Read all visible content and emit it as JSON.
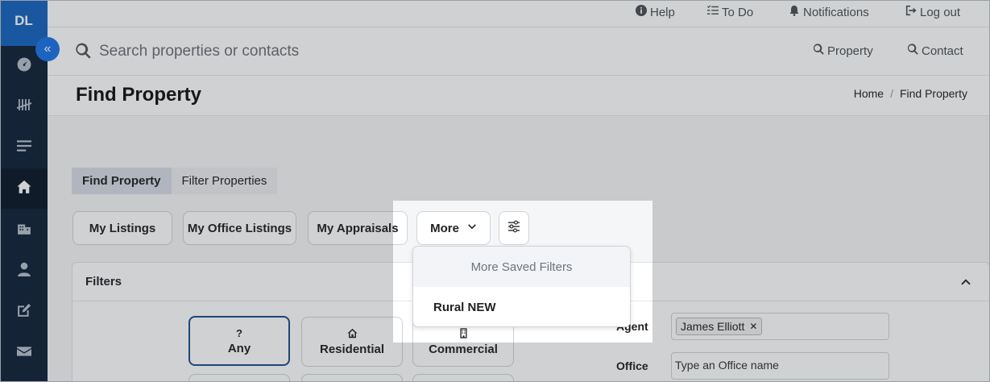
{
  "app": {
    "logo": "DL"
  },
  "sidebar": {
    "collapse_icon": "double-chevron-left-icon",
    "items": [
      {
        "name": "dashboard",
        "icon": "gauge-icon"
      },
      {
        "name": "tally",
        "icon": "tally-icon"
      },
      {
        "name": "list",
        "icon": "list-icon"
      },
      {
        "name": "home",
        "icon": "home-icon",
        "active": true
      },
      {
        "name": "buildings",
        "icon": "building-icon"
      },
      {
        "name": "contacts",
        "icon": "person-icon"
      },
      {
        "name": "edit",
        "icon": "pencil-square-icon"
      },
      {
        "name": "mail",
        "icon": "envelope-icon"
      }
    ]
  },
  "topnav": {
    "help": "Help",
    "todo": "To Do",
    "notifications": "Notifications",
    "logout": "Log out"
  },
  "search": {
    "placeholder": "Search properties or contacts",
    "property": "Property",
    "contact": "Contact"
  },
  "page": {
    "title": "Find Property",
    "breadcrumb": {
      "home": "Home",
      "separator": "/",
      "current": "Find Property"
    }
  },
  "tabs": {
    "find": "Find Property",
    "filter": "Filter Properties"
  },
  "quick_filters": {
    "my_listings": "My Listings",
    "my_office_listings": "My Office Listings",
    "my_appraisals": "My Appraisals",
    "more": "More"
  },
  "dropdown": {
    "header": "More Saved Filters",
    "items": [
      "Rural NEW"
    ]
  },
  "filters": {
    "title": "Filters",
    "property_types": [
      {
        "icon_glyph": "?",
        "label": "Any",
        "selected": true
      },
      {
        "icon": "house-outline-icon",
        "label": "Residential"
      },
      {
        "icon": "office-building-icon",
        "label": "Commercial"
      }
    ],
    "agent_label": "Agent",
    "agent_value": "James Elliott",
    "office_label": "Office",
    "office_placeholder": "Type an Office name"
  },
  "colors": {
    "sidebar": "#0f2138",
    "logo": "#1565c0",
    "accent": "#1a73e8",
    "selected_border": "#1f4e8c"
  }
}
